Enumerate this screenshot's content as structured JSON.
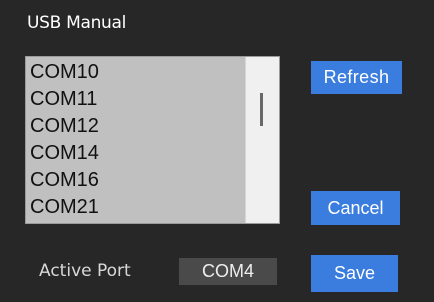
{
  "window": {
    "title": "USB Manual"
  },
  "port_list": {
    "items": [
      "COM10",
      "COM11",
      "COM12",
      "COM14",
      "COM16",
      "COM21"
    ]
  },
  "buttons": {
    "refresh_label": "Refresh",
    "cancel_label": "Cancel",
    "save_label": "Save"
  },
  "active_port": {
    "label": "Active Port",
    "value": "COM4"
  },
  "colors": {
    "background": "#272727",
    "button_accent": "#3a7dde",
    "list_background": "#c0c0c0"
  }
}
